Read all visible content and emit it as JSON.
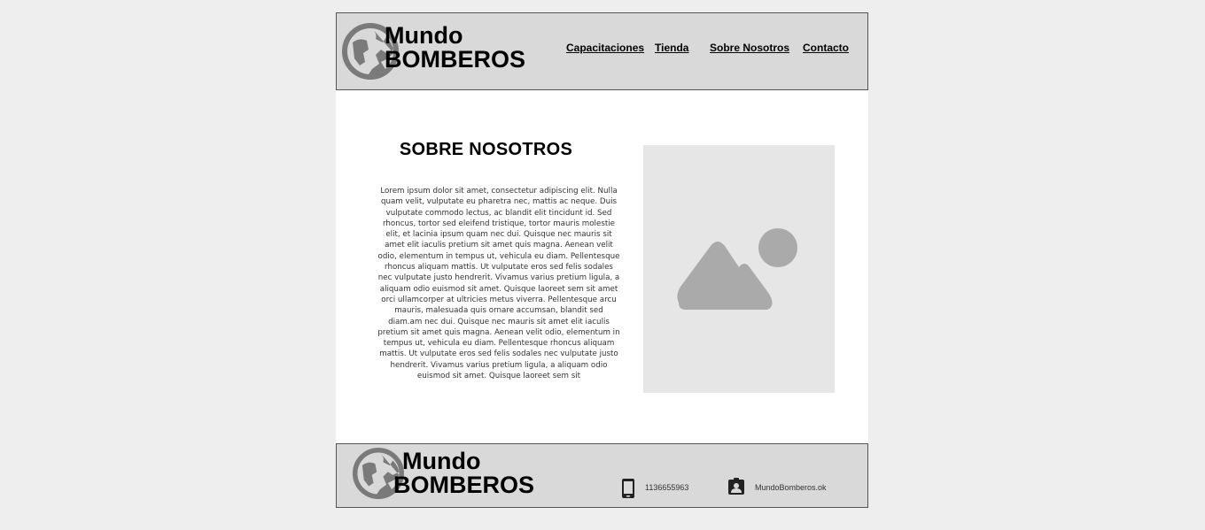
{
  "header": {
    "brand_line1": "Mundo",
    "brand_line2": "BOMBEROS",
    "nav": [
      {
        "label": "Capacitaciones"
      },
      {
        "label": "Tienda"
      },
      {
        "label": "Sobre Nosotros"
      },
      {
        "label": "Contacto"
      }
    ]
  },
  "main": {
    "title": "SOBRE NOSOTROS",
    "body": "Lorem ipsum dolor sit amet, consectetur adipiscing elit. Nulla quam velit, vulputate eu pharetra nec, mattis ac neque. Duis vulputate commodo lectus, ac blandit elit tincidunt id. Sed rhoncus, tortor sed eleifend tristique, tortor mauris molestie elit, et lacinia ipsum quam nec dui. Quisque nec mauris sit amet elit iaculis pretium sit amet quis magna. Aenean velit odio, elementum in tempus ut, vehicula eu diam. Pellentesque rhoncus aliquam mattis. Ut vulputate eros sed felis sodales nec vulputate justo hendrerit. Vivamus varius pretium ligula, a aliquam odio euismod sit amet. Quisque laoreet sem sit amet orci ullamcorper at ultricies metus viverra. Pellentesque arcu mauris, malesuada quis ornare accumsan, blandit sed diam.am nec dui. Quisque nec mauris sit amet elit iaculis pretium sit amet quis magna. Aenean velit odio, elementum in tempus ut, vehicula eu diam. Pellentesque rhoncus aliquam mattis. Ut vulputate eros sed felis sodales nec vulputate justo hendrerit. Vivamus varius pretium ligula, a aliquam odio euismod sit amet. Quisque laoreet sem sit"
  },
  "footer": {
    "brand_line1": "Mundo",
    "brand_line2": "BOMBEROS",
    "phone": "1136655963",
    "account": "MundoBomberos.ok"
  },
  "icons": {
    "logo": "globe-icon",
    "image": "image-placeholder-icon",
    "phone": "smartphone-icon",
    "account": "contact-badge-icon"
  },
  "colors": {
    "header_bg": "#d9d9d9",
    "icon_gray": "#7a7a7a",
    "placeholder_bg": "#e6e6e6",
    "placeholder_shape": "#aaaaaa"
  }
}
